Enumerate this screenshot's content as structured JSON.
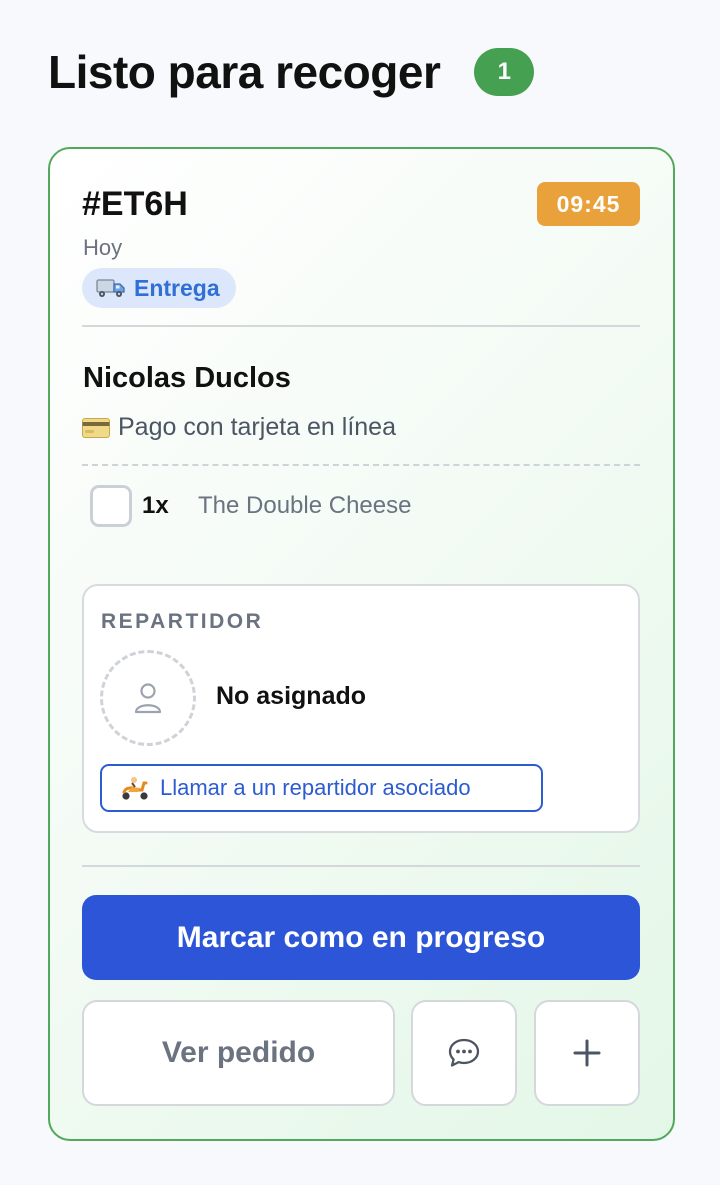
{
  "header": {
    "title": "Listo para recoger",
    "count": "1"
  },
  "order": {
    "id": "#ET6H",
    "time": "09:45",
    "day": "Hoy",
    "type_label": "Entrega",
    "type_icon": "truck-icon",
    "customer_name": "Nicolas Duclos",
    "payment": "Pago con tarjeta en línea",
    "payment_icon": "credit-card-icon",
    "items": [
      {
        "qty": "1x",
        "name": "The Double Cheese",
        "checked": false
      }
    ]
  },
  "courier": {
    "section_label": "REPARTIDOR",
    "status": "No asignado",
    "call_button_label": "Llamar a un repartidor asociado",
    "call_button_icon": "scooter-icon"
  },
  "actions": {
    "primary_label": "Marcar como en progreso",
    "view_order_label": "Ver pedido",
    "chat_icon": "chat-icon",
    "more_icon": "plus-icon"
  },
  "colors": {
    "accent_blue": "#2c55d8",
    "success_green": "#46a052",
    "time_orange": "#e9a23b",
    "chip_blue": "#2f6fd6"
  }
}
